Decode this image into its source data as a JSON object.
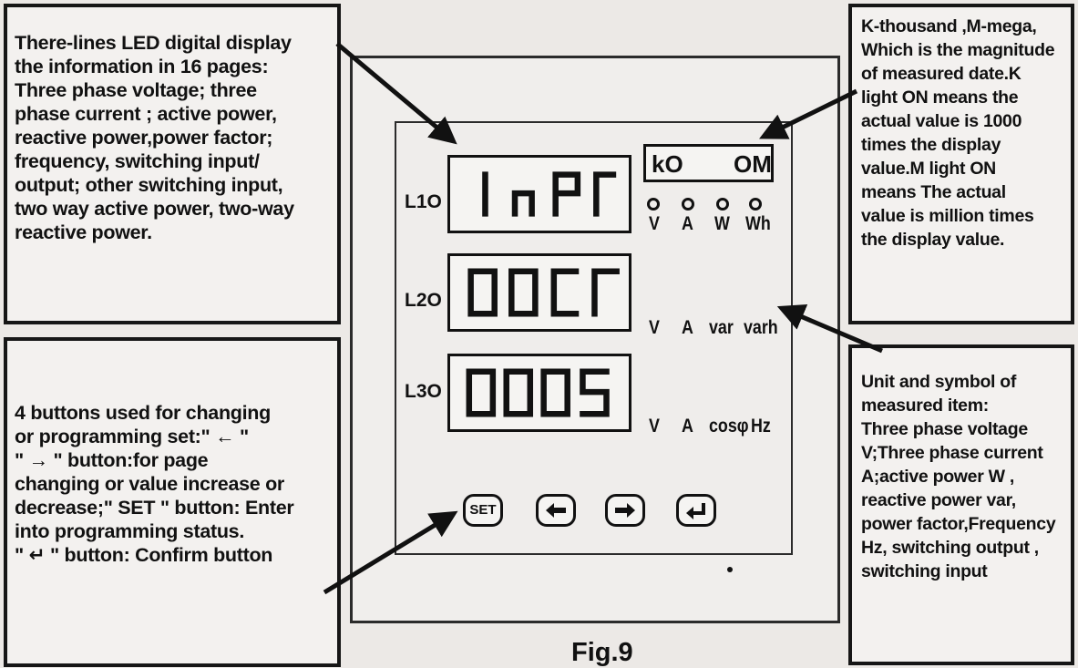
{
  "note_display": [
    "There-lines LED digital display",
    "the information in 16 pages:",
    "Three phase voltage; three",
    "phase current ; active power,",
    "reactive power,power factor;",
    "frequency, switching input/",
    "output; other switching input,",
    "two way active power, two-way",
    "reactive power."
  ],
  "note_buttons": [
    "4 buttons used for changing",
    "or programming set:\" ← \"",
    "\" → \" button:for page",
    "changing or value increase or",
    "decrease;\" SET \" button: Enter",
    "into programming status.",
    "\" ↵ \" button: Confirm button"
  ],
  "note_magnitude": [
    "K-thousand ,M-mega,",
    "Which is the magnitude",
    "of measured date.K",
    "light ON means the",
    "actual value is 1000",
    "times the display",
    "value.M light ON",
    "means The actual",
    "value is million times",
    "the display value."
  ],
  "note_units": [
    "Unit and symbol of",
    "measured item:",
    "Three phase voltage",
    "V;Three phase current",
    "A;active power W ,",
    "reactive  power var,",
    "power factor,Frequency",
    "Hz, switching  output ,",
    "switching input"
  ],
  "meter": {
    "line_labels": [
      "L1O",
      "L2O",
      "L3O"
    ],
    "displays": [
      "InPr",
      "00Cr",
      "0005"
    ],
    "k_label": "kO",
    "m_label": "OM",
    "units_row1": [
      "V",
      "A",
      "W",
      "Wh"
    ],
    "units_row2": [
      "V",
      "A",
      "var",
      "varh"
    ],
    "units_row3": [
      "V",
      "A",
      "cosφ",
      "Hz"
    ],
    "buttons": {
      "set": "SET"
    }
  },
  "caption": "Fig.9"
}
